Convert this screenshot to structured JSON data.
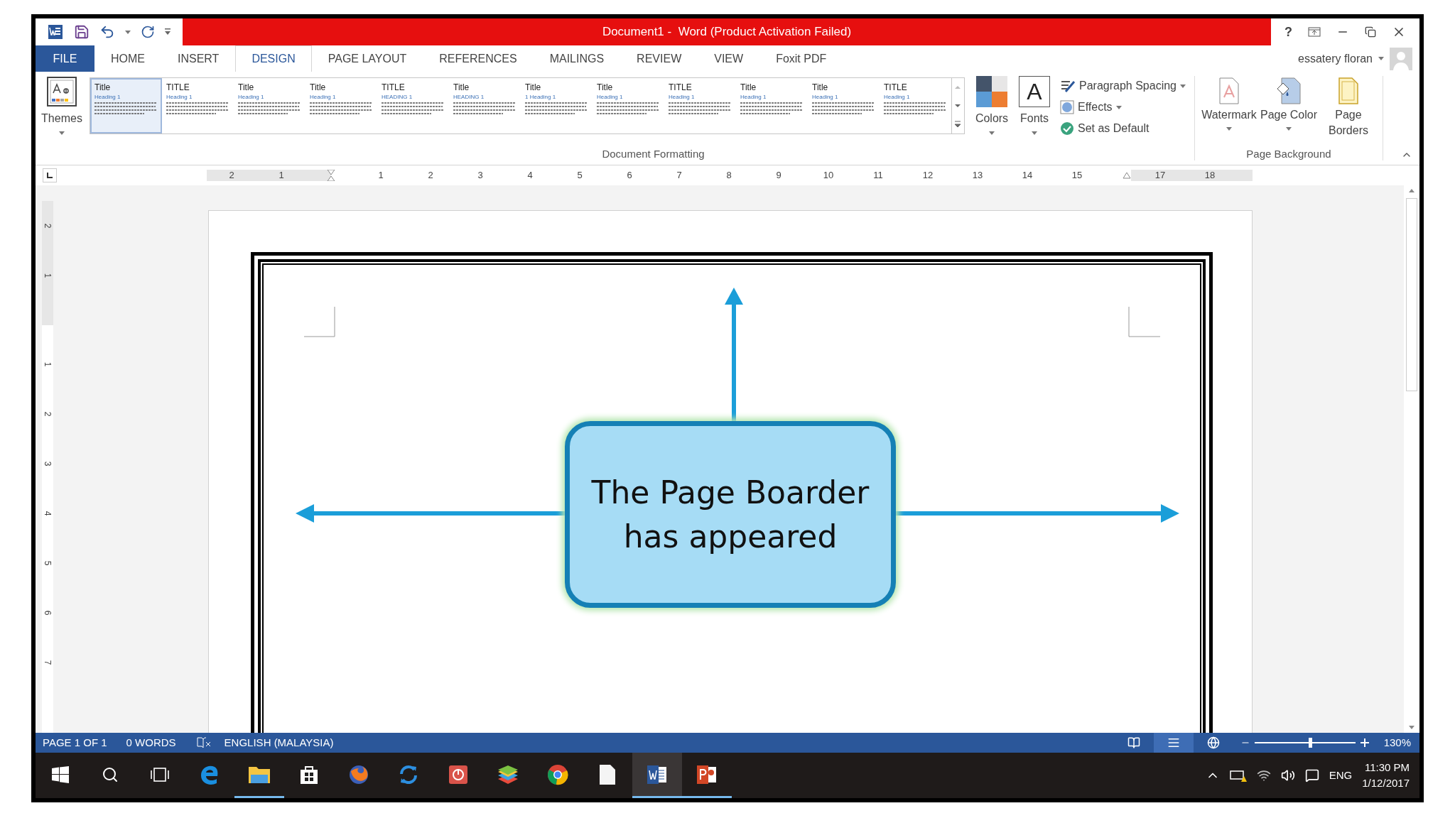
{
  "window": {
    "title": "Document1 -  Word (Product Activation Failed)",
    "help": "?"
  },
  "tabs": [
    {
      "label": "FILE",
      "kind": "file",
      "selected": false
    },
    {
      "label": "HOME",
      "kind": "tab",
      "selected": false
    },
    {
      "label": "INSERT",
      "kind": "tab",
      "selected": false
    },
    {
      "label": "DESIGN",
      "kind": "tab",
      "selected": true
    },
    {
      "label": "PAGE LAYOUT",
      "kind": "tab",
      "selected": false
    },
    {
      "label": "REFERENCES",
      "kind": "tab",
      "selected": false
    },
    {
      "label": "MAILINGS",
      "kind": "tab",
      "selected": false
    },
    {
      "label": "REVIEW",
      "kind": "tab",
      "selected": false
    },
    {
      "label": "VIEW",
      "kind": "tab",
      "selected": false
    },
    {
      "label": "Foxit PDF",
      "kind": "tab",
      "selected": false
    }
  ],
  "account": {
    "name": "essatery floran"
  },
  "ribbon": {
    "themes_label": "Themes",
    "gallery": [
      {
        "title": "Title",
        "heading": "Heading 1",
        "selected": true
      },
      {
        "title": "TITLE",
        "heading": "Heading 1",
        "selected": false
      },
      {
        "title": "Title",
        "heading": "Heading 1",
        "selected": false
      },
      {
        "title": "Title",
        "heading": "Heading 1",
        "selected": false
      },
      {
        "title": "TITLE",
        "heading": "HEADING 1",
        "selected": false
      },
      {
        "title": "Title",
        "heading": "HEADING 1",
        "selected": false
      },
      {
        "title": "Title",
        "heading": "1 Heading 1",
        "selected": false
      },
      {
        "title": "Title",
        "heading": "Heading 1",
        "selected": false
      },
      {
        "title": "TITLE",
        "heading": "Heading 1",
        "selected": false
      },
      {
        "title": "Title",
        "heading": "Heading 1",
        "selected": false
      },
      {
        "title": "Title",
        "heading": "Heading 1",
        "selected": false
      },
      {
        "title": "TITLE",
        "heading": "Heading 1",
        "selected": false
      }
    ],
    "formatting_group": "Document Formatting",
    "colors_label": "Colors",
    "fonts_label": "Fonts",
    "font_glyph": "A",
    "paragraph_spacing": "Paragraph Spacing",
    "effects": "Effects",
    "set_default": "Set as Default",
    "background_buttons": [
      {
        "label": "Watermark",
        "kind": "watermark",
        "dropdown": true
      },
      {
        "label": "Page Color",
        "kind": "color",
        "dropdown": true
      },
      {
        "label": "Page Borders",
        "kind": "borders",
        "dropdown": false
      }
    ],
    "background_group": "Page Background"
  },
  "ruler": {
    "left_labels": [
      "2",
      "1"
    ],
    "labels": [
      "1",
      "2",
      "3",
      "4",
      "5",
      "6",
      "7",
      "8",
      "9",
      "10",
      "11",
      "12",
      "13",
      "14",
      "15"
    ],
    "right_labels": [
      "17",
      "18"
    ]
  },
  "vertical_ruler": {
    "top_labels": [
      "2",
      "1"
    ],
    "labels": [
      "1",
      "2",
      "3",
      "4",
      "5",
      "6",
      "7"
    ]
  },
  "callout": {
    "text": "The Page Boarder has appeared"
  },
  "status_bar": {
    "page": "PAGE 1 OF 1",
    "words": "0 WORDS",
    "language": "ENGLISH (MALAYSIA)",
    "views": [
      {
        "kind": "read",
        "selected": false
      },
      {
        "kind": "print",
        "selected": true
      },
      {
        "kind": "web",
        "selected": false
      }
    ],
    "zoom_slider": {
      "level": 0.55
    },
    "zoom": "130%"
  },
  "taskbar": {
    "apps": [
      {
        "kind": "start",
        "open": false,
        "selected": false
      },
      {
        "kind": "search",
        "open": false,
        "selected": false
      },
      {
        "kind": "taskview",
        "open": false,
        "selected": false
      },
      {
        "kind": "edge",
        "open": false,
        "selected": false
      },
      {
        "kind": "explorer",
        "open": true,
        "selected": false
      },
      {
        "kind": "store",
        "open": false,
        "selected": false
      },
      {
        "kind": "firefox",
        "open": false,
        "selected": false
      },
      {
        "kind": "sync",
        "open": false,
        "selected": false
      },
      {
        "kind": "power",
        "open": false,
        "selected": false
      },
      {
        "kind": "layers",
        "open": false,
        "selected": false
      },
      {
        "kind": "chrome",
        "open": false,
        "selected": false
      },
      {
        "kind": "file",
        "open": false,
        "selected": false
      },
      {
        "kind": "word",
        "open": true,
        "selected": true
      },
      {
        "kind": "powerpoint",
        "open": true,
        "selected": false
      }
    ],
    "language": "ENG",
    "time": "11:30 PM",
    "date": "1/12/2017"
  }
}
